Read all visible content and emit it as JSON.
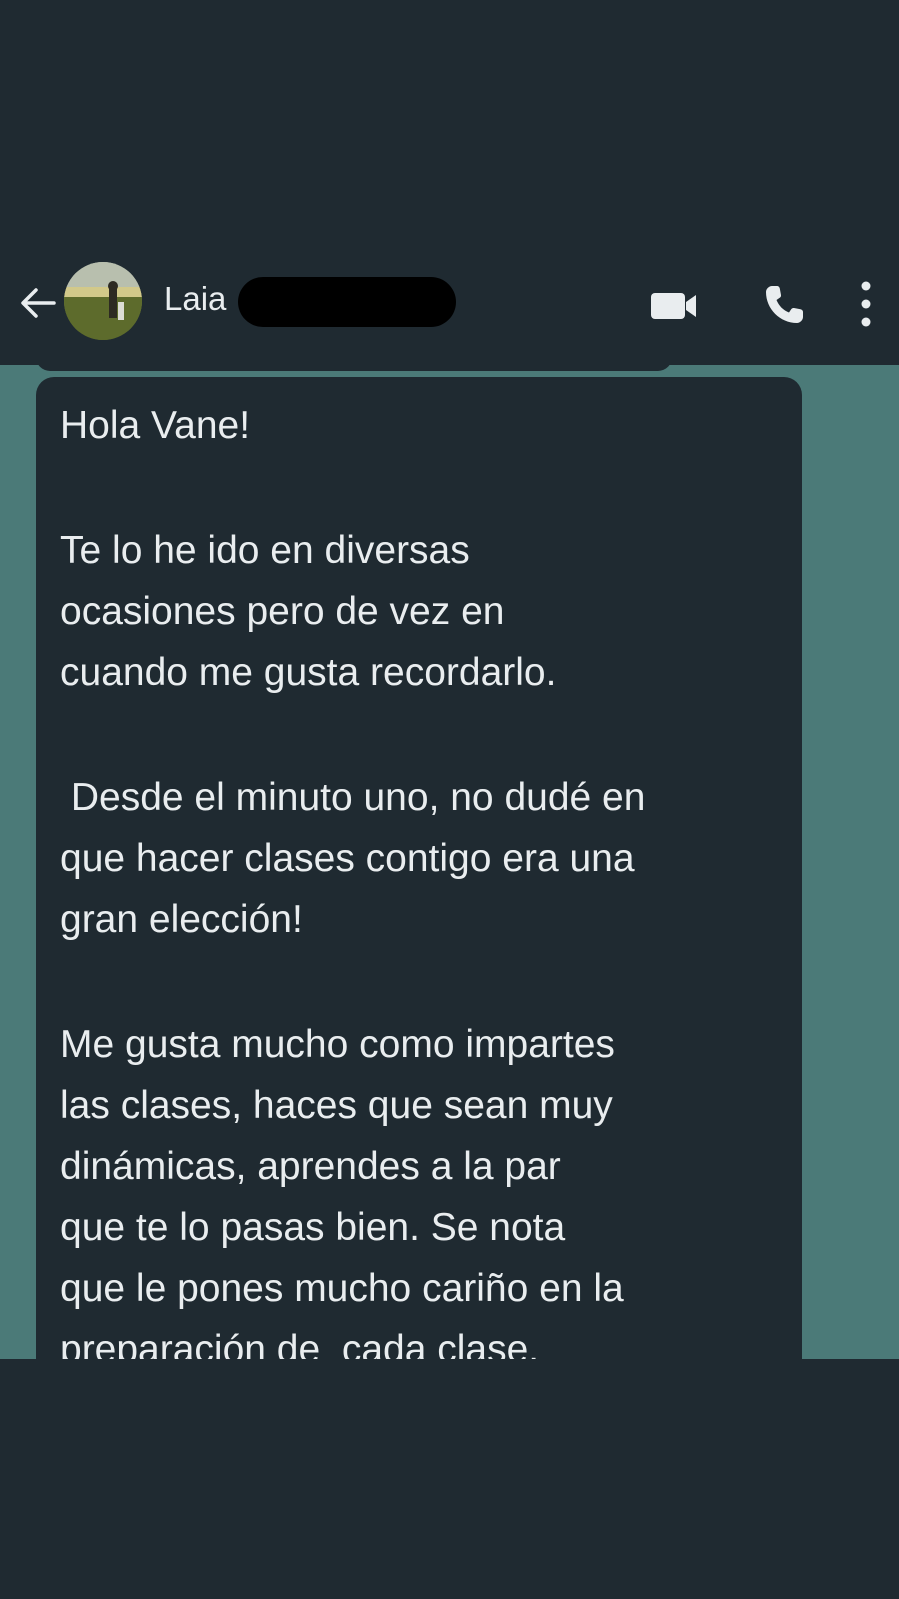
{
  "header": {
    "contact_name": "Laia",
    "icons": {
      "back": "arrow-left-icon",
      "video": "video-call-icon",
      "call": "phone-icon",
      "menu": "more-vert-icon"
    }
  },
  "message": {
    "paragraphs": [
      "Hola Vane!",
      "Te lo he ido en diversas\nocasiones pero de vez en\ncuando me gusta recordarlo.",
      " Desde el minuto uno, no dudé en\nque hacer clases contigo era una\ngran elección!",
      "Me gusta mucho como impartes\nlas clases, haces que sean muy\ndinámicas, aprendes a la par\nque te lo pasas bien. Se nota\nque le pones mucho cariño en la\npreparación de  cada clase."
    ]
  },
  "colors": {
    "background": "#1f2a31",
    "chat_wallpaper": "#4b7a78",
    "bubble": "#1f2a31",
    "text": "#e9edef"
  }
}
